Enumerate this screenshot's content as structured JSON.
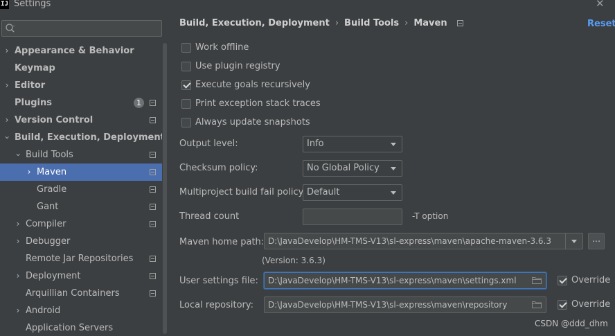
{
  "window": {
    "title": "Settings",
    "logo_text": "IJ"
  },
  "search": {
    "placeholder": ""
  },
  "sidebar": {
    "items": [
      {
        "label": "Appearance & Behavior"
      },
      {
        "label": "Keymap"
      },
      {
        "label": "Editor"
      },
      {
        "label": "Plugins",
        "badge": "1"
      },
      {
        "label": "Version Control"
      },
      {
        "label": "Build, Execution, Deployment"
      },
      {
        "label": "Build Tools"
      },
      {
        "label": "Maven"
      },
      {
        "label": "Gradle"
      },
      {
        "label": "Gant"
      },
      {
        "label": "Compiler"
      },
      {
        "label": "Debugger"
      },
      {
        "label": "Remote Jar Repositories"
      },
      {
        "label": "Deployment"
      },
      {
        "label": "Arquillian Containers"
      },
      {
        "label": "Android"
      },
      {
        "label": "Application Servers"
      }
    ]
  },
  "breadcrumb": {
    "items": [
      "Build, Execution, Deployment",
      "Build Tools",
      "Maven"
    ],
    "separator": "›"
  },
  "header": {
    "reset_label": "Reset"
  },
  "options": {
    "work_offline": {
      "label": "Work offline",
      "checked": false
    },
    "use_plugin_registry": {
      "label": "Use plugin registry",
      "checked": false
    },
    "execute_goals_recursively": {
      "label": "Execute goals recursively",
      "checked": true
    },
    "print_exception_stack_traces": {
      "label": "Print exception stack traces",
      "checked": false
    },
    "always_update_snapshots": {
      "label": "Always update snapshots",
      "checked": false
    }
  },
  "fields": {
    "output_level": {
      "label": "Output level:",
      "value": "Info"
    },
    "checksum_policy": {
      "label": "Checksum policy:",
      "value": "No Global Policy"
    },
    "multiproject_fail_policy": {
      "label": "Multiproject build fail policy:",
      "value": "Default"
    },
    "thread_count": {
      "label": "Thread count",
      "value": "",
      "hint": "-T option"
    },
    "maven_home": {
      "label": "Maven home path:",
      "value": "D:\\JavaDevelop\\HM-TMS-V13\\sl-express\\maven\\apache-maven-3.6.3",
      "browse_label": "...",
      "version_note": "(Version: 3.6.3)"
    },
    "user_settings": {
      "label": "User settings file:",
      "value": "D:\\JavaDevelop\\HM-TMS-V13\\sl-express\\maven\\settings.xml",
      "override_label": "Override",
      "override_checked": true
    },
    "local_repository": {
      "label": "Local repository:",
      "value": "D:\\JavaDevelop\\HM-TMS-V13\\sl-express\\maven\\repository",
      "override_label": "Override",
      "override_checked": true
    }
  },
  "watermark": "CSDN @ddd_dhm",
  "colors": {
    "accent": "#4b6eaf",
    "link": "#589df6",
    "background": "#3c3f41"
  }
}
